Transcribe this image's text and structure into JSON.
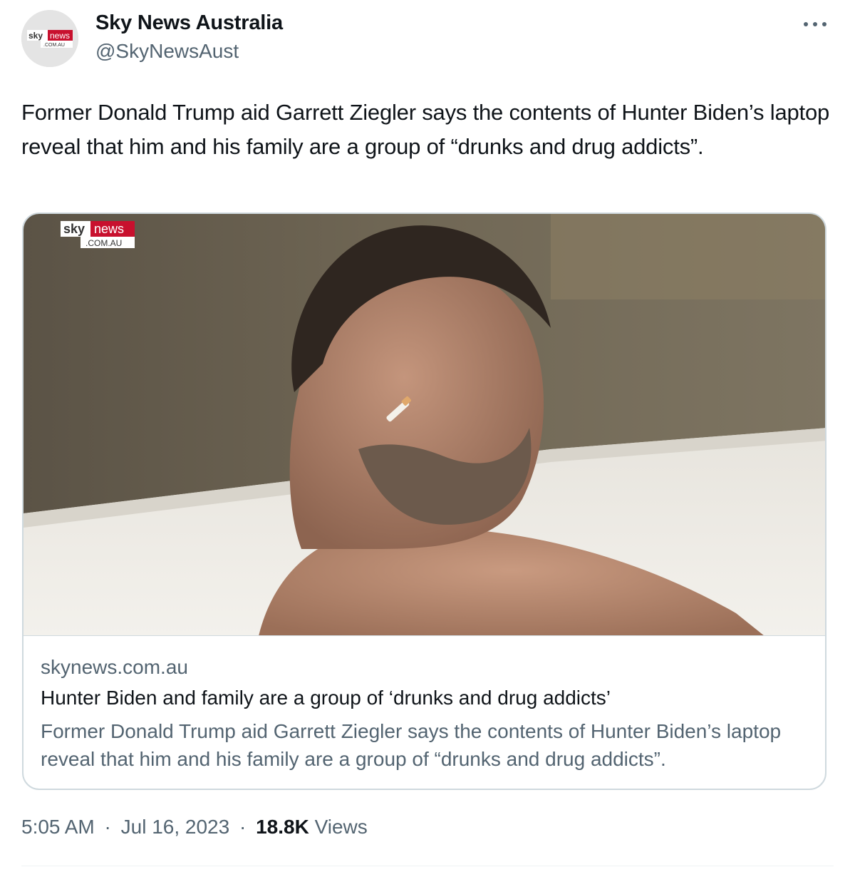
{
  "author": {
    "display_name": "Sky News Australia",
    "handle": "@SkyNewsAust",
    "avatar_logo": {
      "sky": "sky",
      "news": "news",
      "domain": ".COM.AU"
    }
  },
  "more_icon": "more-dots-icon",
  "tweet": {
    "text": "Former Donald Trump aid Garrett Ziegler says the contents of Hunter Biden’s laptop reveal that him and his family are a group of “drunks and drug addicts”."
  },
  "card": {
    "image_watermark": {
      "sky": "sky",
      "news": "news",
      "domain": ".COM.AU"
    },
    "domain": "skynews.com.au",
    "title": "Hunter Biden and family are a group of ‘drunks and drug addicts’",
    "description": "Former Donald Trump aid Garrett Ziegler says the contents of Hunter Biden’s laptop reveal that him and his family are a group of “drunks and drug addicts”."
  },
  "meta": {
    "time": "5:05 AM",
    "date": "Jul 16, 2023",
    "separator": "·",
    "views_count": "18.8K",
    "views_label": "Views"
  },
  "colors": {
    "brand_red": "#c8102e",
    "text_primary": "#0f1419",
    "text_secondary": "#536471",
    "border": "#cfd9de"
  }
}
